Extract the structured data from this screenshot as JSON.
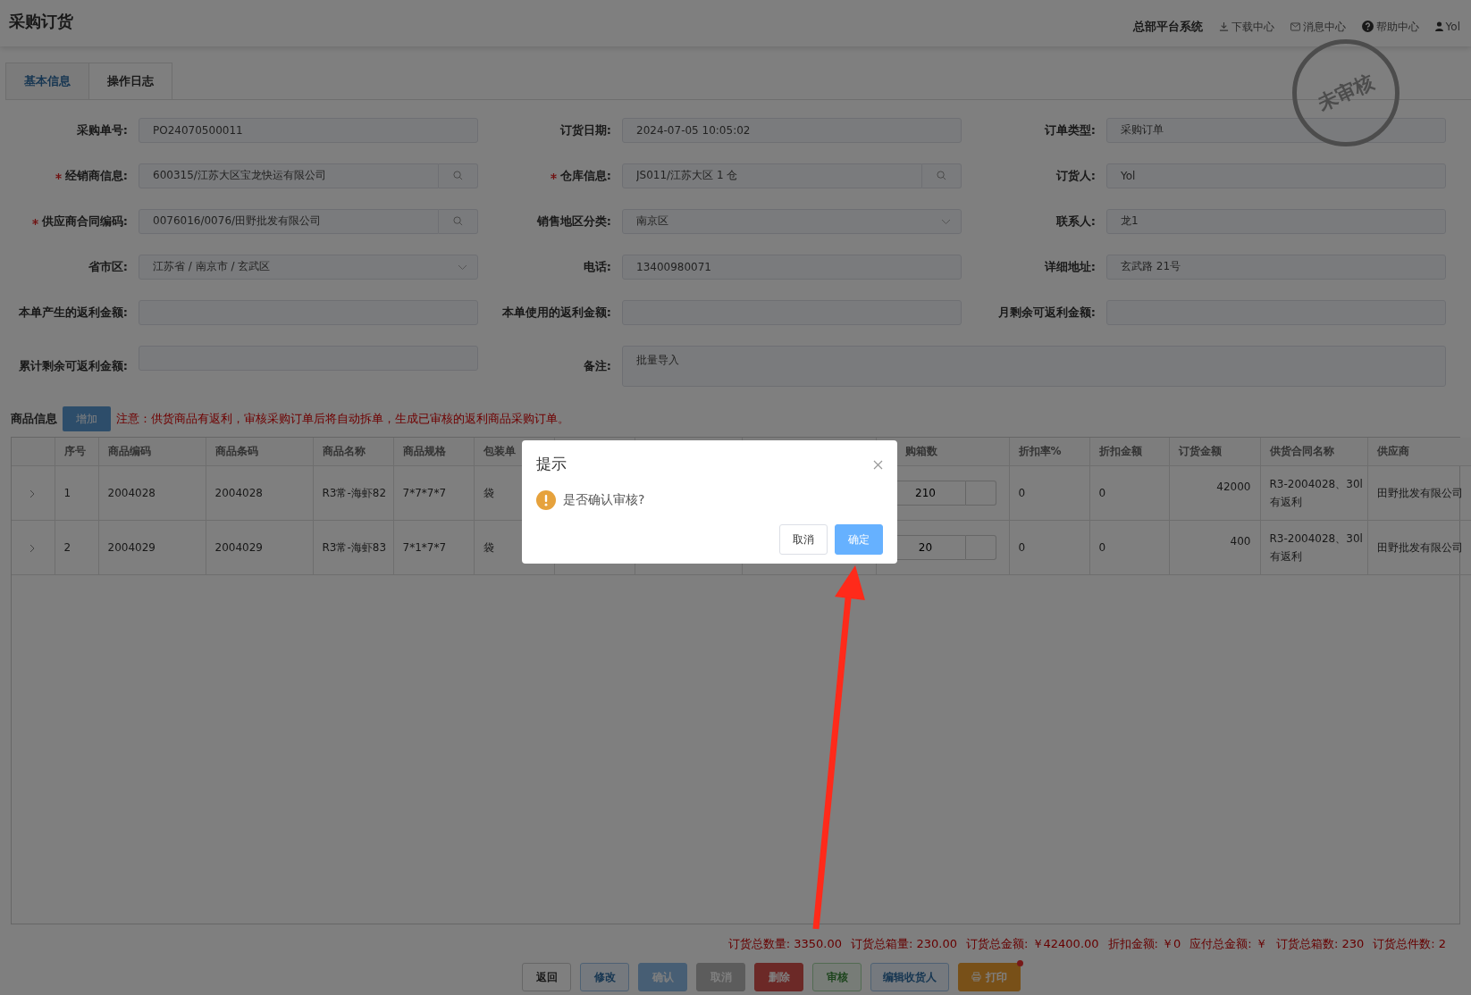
{
  "header": {
    "title": "采购订货",
    "system": "总部平台系统",
    "links": [
      {
        "kind": "download",
        "label": "下载中心"
      },
      {
        "kind": "message",
        "label": "消息中心"
      },
      {
        "kind": "help",
        "label": "帮助中心"
      },
      {
        "kind": "user",
        "label": "Yol"
      }
    ]
  },
  "tabs": [
    {
      "label": "基本信息",
      "selected": true
    },
    {
      "label": "操作日志",
      "selected": false
    }
  ],
  "stamp": "未审核",
  "form": [
    {
      "label": "采购单号:",
      "required": false,
      "kind": "text",
      "value": "PO24070500011"
    },
    {
      "label": "订货日期:",
      "required": false,
      "kind": "text",
      "value": "2024-07-05 10:05:02"
    },
    {
      "label": "订单类型:",
      "required": false,
      "kind": "text",
      "value": "采购订单"
    },
    {
      "label": "经销商信息:",
      "required": true,
      "kind": "search",
      "value": "600315/江苏大区宝龙快运有限公司"
    },
    {
      "label": "仓库信息:",
      "required": true,
      "kind": "search",
      "value": "JS011/江苏大区 1 仓"
    },
    {
      "label": "订货人:",
      "required": false,
      "kind": "text",
      "value": "Yol"
    },
    {
      "label": "供应商合同编码:",
      "required": true,
      "kind": "search",
      "value": "0076016/0076/田野批发有限公司"
    },
    {
      "label": "销售地区分类:",
      "required": false,
      "kind": "select",
      "value": "南京区"
    },
    {
      "label": "联系人:",
      "required": false,
      "kind": "text",
      "value": "龙1"
    },
    {
      "label": "省市区:",
      "required": false,
      "kind": "select",
      "value": "江苏省 / 南京市 / 玄武区"
    },
    {
      "label": "电话:",
      "required": false,
      "kind": "text",
      "value": "13400980071"
    },
    {
      "label": "详细地址:",
      "required": false,
      "kind": "text",
      "value": "玄武路 21号"
    },
    {
      "label": "本单产生的返利金额:",
      "required": false,
      "kind": "text"
    },
    {
      "label": "本单使用的返利金额:",
      "required": false,
      "kind": "text"
    },
    {
      "label": "月剩余可返利金额:",
      "required": false,
      "kind": "text"
    },
    {
      "label": "累计剩余可返利金额:",
      "required": false,
      "kind": "text"
    },
    {
      "label": "备注:",
      "required": false,
      "kind": "textarea",
      "value": "批量导入"
    }
  ],
  "products": {
    "title": "商品信息",
    "add_button": "增加",
    "note": "注意：供货商品有返利，审核采购订单后将自动拆单，生成已审核的返利商品采购订单。",
    "columns": [
      {
        "kind": "expand"
      },
      {
        "kind": "text",
        "label": "序号"
      },
      {
        "kind": "text",
        "label": "商品编码"
      },
      {
        "kind": "text",
        "label": "商品条码"
      },
      {
        "kind": "text",
        "label": "商品名称"
      },
      {
        "kind": "text",
        "label": "商品规格"
      },
      {
        "kind": "text",
        "label": "包装单"
      },
      {
        "kind": "text"
      },
      {
        "kind": "text"
      },
      {
        "kind": "text"
      },
      {
        "kind": "stepper",
        "label": "购箱数"
      },
      {
        "kind": "text",
        "label": "折扣率%"
      },
      {
        "kind": "text",
        "label": "折扣金额"
      },
      {
        "kind": "amount",
        "label": "订货金额"
      },
      {
        "kind": "multiline",
        "label": "供货合同名称"
      },
      {
        "kind": "text",
        "label": "供应商"
      }
    ],
    "rows": [
      {
        "cells": [
          null,
          "1",
          "2004028",
          "2004028",
          "R3常-海虾82",
          "7*7*7*7",
          "袋",
          null,
          null,
          null,
          "210",
          "0",
          "0",
          "42000",
          [
            "R3-2004028、30l",
            "有返利"
          ],
          "田野批发有限公司"
        ]
      },
      {
        "cells": [
          null,
          "2",
          "2004029",
          "2004029",
          "R3常-海虾83",
          "7*1*7*7",
          "袋",
          null,
          null,
          null,
          "20",
          "0",
          "0",
          "400",
          [
            "R3-2004028、30l",
            "有返利"
          ],
          "田野批发有限公司"
        ]
      }
    ]
  },
  "summary": [
    "订货总数量: 3350.00",
    "订货总箱量: 230.00",
    "订货总金额: ￥42400.00",
    "折扣金额: ￥0",
    "应付总金额: ￥",
    "订货总箱数: 230",
    "订货总件数: 2"
  ],
  "actions": [
    {
      "label": "返回",
      "kind": "default"
    },
    {
      "label": "修改",
      "kind": "info"
    },
    {
      "label": "确认",
      "kind": "primary"
    },
    {
      "label": "取消",
      "kind": "muted"
    },
    {
      "label": "删除",
      "kind": "danger"
    },
    {
      "label": "审核",
      "kind": "success"
    },
    {
      "label": "编辑收货人",
      "kind": "info"
    },
    {
      "label": "打印",
      "kind": "print"
    }
  ],
  "dialog": {
    "title": "提示",
    "message": "是否确认审核?",
    "buttons": [
      {
        "label": "取消",
        "kind": "default"
      },
      {
        "label": "确定",
        "kind": "primary"
      }
    ]
  }
}
